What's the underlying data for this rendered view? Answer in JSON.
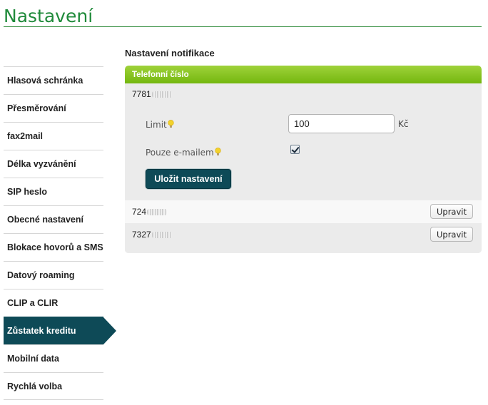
{
  "page": {
    "title": "Nastavení"
  },
  "sidebar": {
    "items": [
      {
        "label": "Hlasová schránka"
      },
      {
        "label": "Přesměrování"
      },
      {
        "label": "fax2mail"
      },
      {
        "label": "Délka vyzvánění"
      },
      {
        "label": "SIP heslo"
      },
      {
        "label": "Obecné nastavení"
      },
      {
        "label": "Blokace hovorů a SMS"
      },
      {
        "label": "Datový roaming"
      },
      {
        "label": "CLIP a CLIR"
      },
      {
        "label": "Zůstatek kreditu",
        "active": true
      },
      {
        "label": "Mobilní data"
      },
      {
        "label": "Rychlá volba"
      }
    ]
  },
  "main": {
    "heading": "Nastavení notifikace",
    "panel": {
      "header": "Telefonní číslo",
      "numbers": [
        {
          "visible_part": "7781",
          "expanded": true
        },
        {
          "visible_part": "724",
          "edit_label": "Upravit"
        },
        {
          "visible_part": "7327",
          "edit_label": "Upravit"
        }
      ],
      "form": {
        "limit_label": "Limit",
        "limit_value": "100",
        "limit_unit": "Kč",
        "email_only_label": "Pouze e-mailem",
        "email_only_checked": true,
        "save_label": "Uložit nastavení"
      }
    }
  },
  "colors": {
    "title_green": "#1f8a3a",
    "header_green": "#86c425",
    "active_teal": "#0e4a57",
    "panel_bg": "#ebebeb",
    "bulb_yellow": "#f2d22b"
  },
  "icons": {
    "hint": "lightbulb-icon",
    "check": "checkmark-icon"
  }
}
